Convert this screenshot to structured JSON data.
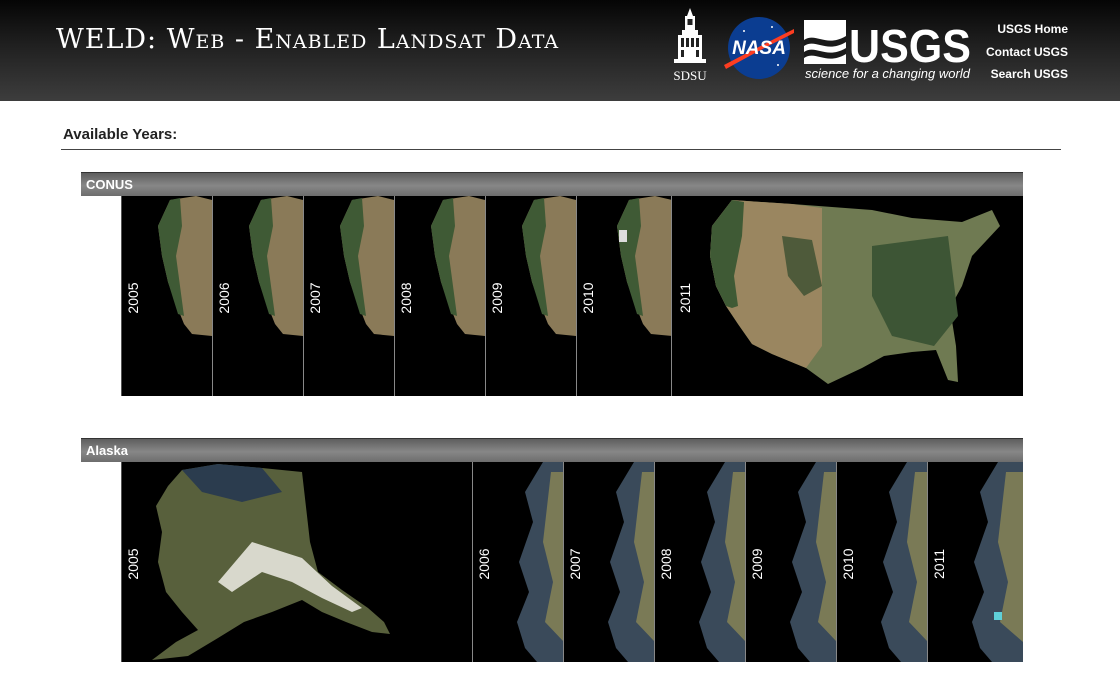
{
  "header": {
    "title": "WELD: Web - Enabled Landsat Data",
    "logos": {
      "sdsu": "SDSU",
      "nasa": "NASA",
      "usgs": "USGS",
      "usgs_tagline": "science for a changing world"
    },
    "links": [
      "USGS Home",
      "Contact USGS",
      "Search USGS"
    ]
  },
  "section_title": "Available Years:",
  "panels": [
    {
      "name": "CONUS",
      "years": [
        "2005",
        "2006",
        "2007",
        "2008",
        "2009",
        "2010",
        "2011"
      ],
      "expanded_year": "2011"
    },
    {
      "name": "Alaska",
      "years": [
        "2005",
        "2006",
        "2007",
        "2008",
        "2009",
        "2010",
        "2011"
      ],
      "expanded_year": "2005"
    }
  ],
  "colors": {
    "header_bg": "#1a1a1a",
    "panel_header": "#7a7a7a",
    "land": "#8a7a58",
    "forest": "#3f5a35",
    "water": "#000000"
  }
}
